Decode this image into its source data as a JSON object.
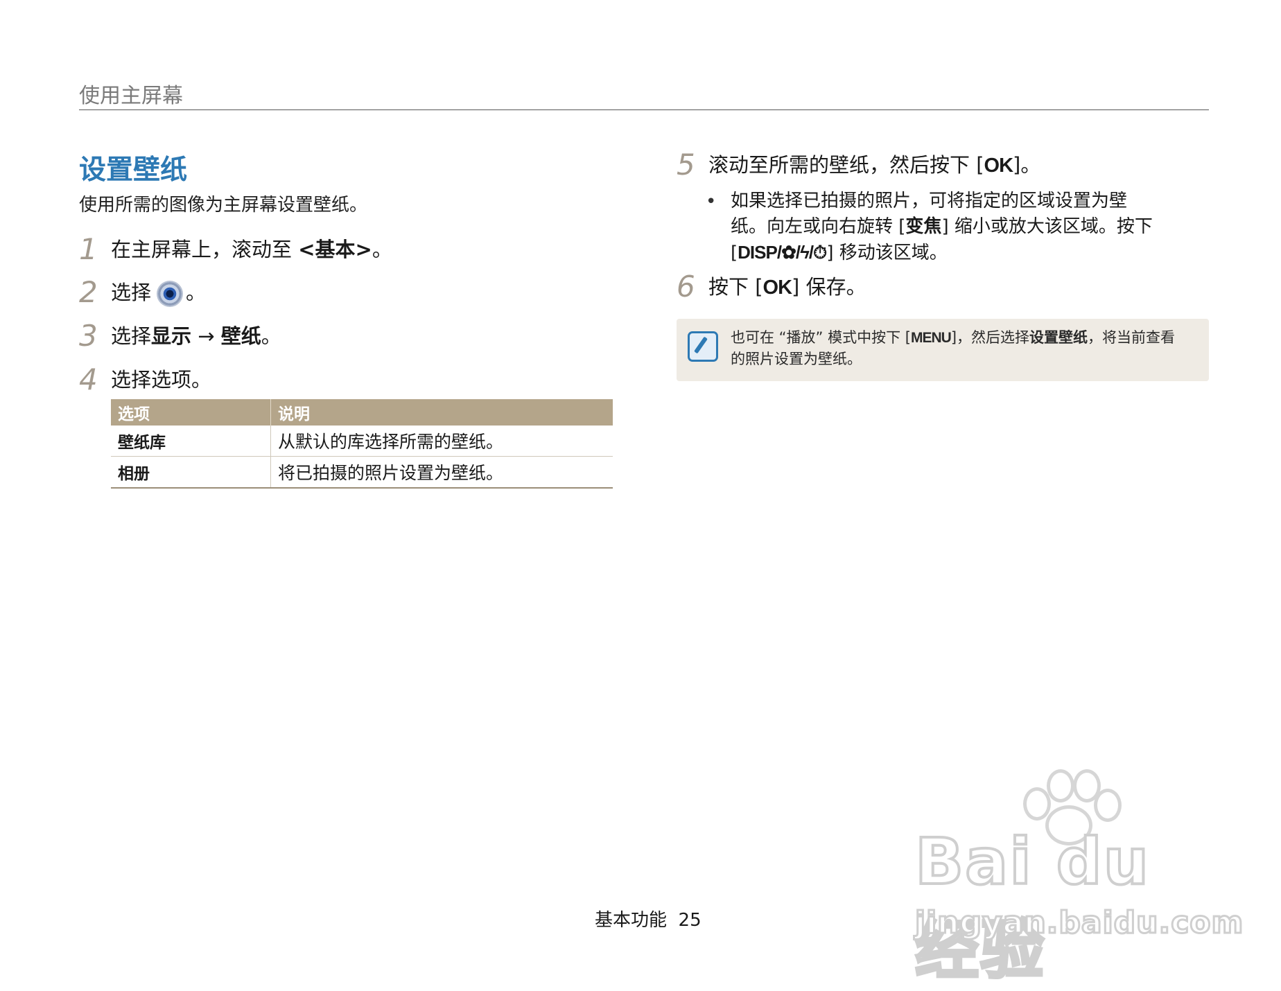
{
  "header": {
    "title": "使用主屏幕"
  },
  "section": {
    "title": "设置壁纸",
    "intro": "使用所需的图像为主屏幕设置壁纸。"
  },
  "steps": {
    "s1": {
      "num": "1",
      "text": "在主屏幕上，滚动至 ",
      "bold": "<基本>",
      "end": "。"
    },
    "s2": {
      "num": "2",
      "text": "选择",
      "icon": "settings-gear-icon",
      "end": "。"
    },
    "s3": {
      "num": "3",
      "text": "选择",
      "bold1": "显示",
      "arrow": " → ",
      "bold2": "壁纸",
      "end": "。"
    },
    "s4": {
      "num": "4",
      "text": "选择选项。"
    },
    "s5": {
      "num": "5",
      "text": "滚动至所需的壁纸，然后按下 [",
      "key": "OK",
      "end": "]。"
    },
    "s6": {
      "num": "6",
      "text": "按下 [",
      "key": "OK",
      "end": "] 保存。"
    }
  },
  "table": {
    "headers": [
      "选项",
      "说明"
    ],
    "rows": [
      [
        "壁纸库",
        "从默认的库选择所需的壁纸。"
      ],
      [
        "相册",
        "将已拍摄的照片设置为壁纸。"
      ]
    ]
  },
  "bullet": {
    "dot": "•",
    "line1": "如果选择已拍摄的照片，可将指定的区域设置为壁",
    "line2a": "纸。向左或向右旋转 [",
    "line2b": "变焦",
    "line2c": "] 缩小或放大该区域。按下",
    "line3a": "[",
    "line3b": "DISP/✿/ϟ/⏱",
    "line3c": "] 移动该区域。"
  },
  "note": {
    "icon": "note-pencil-icon",
    "a": "也可在 “播放” 模式中按下 [",
    "key": "MENU",
    "b": "]，然后选择",
    "bold": "设置壁纸",
    "c": "，将当前查看",
    "d": "的照片设置为壁纸。"
  },
  "footer": {
    "section": "基本功能",
    "page": "25"
  },
  "watermark": {
    "brand": "Bai du 经验",
    "url": "jingyan.baidu.com"
  },
  "colors": {
    "accent": "#2d79b4",
    "table_header": "#b4a58a",
    "note_bg": "#efebe4"
  }
}
